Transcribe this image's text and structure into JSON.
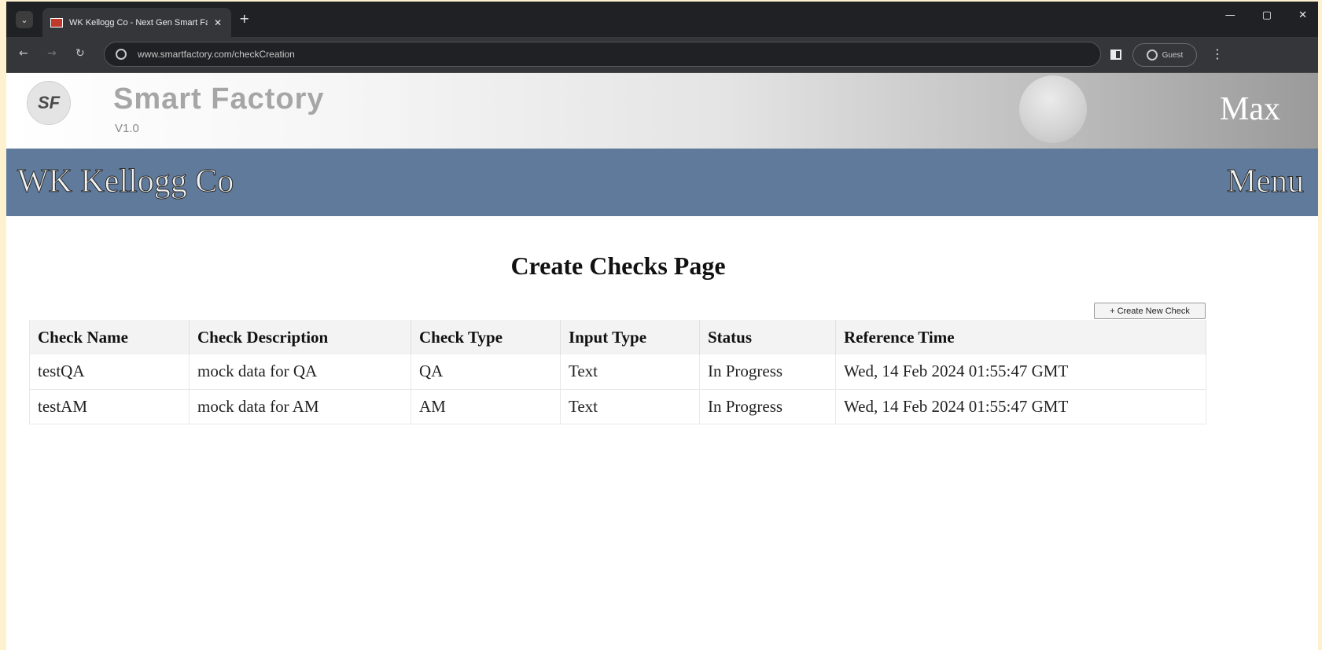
{
  "browser": {
    "tab_title": "WK Kellogg Co - Next Gen Smart Factory",
    "tab_close": "✕",
    "new_tab": "+",
    "url": "www.smartfactory.com/checkCreation",
    "profile_label": "Guest",
    "window_controls": [
      "—",
      "▢",
      "✕"
    ]
  },
  "header": {
    "logo_text": "SF",
    "app_name": "Smart Factory",
    "version": "V1.0",
    "user_name": "Max"
  },
  "company_bar": {
    "company_name": "WK Kellogg Co",
    "menu_label": "Menu"
  },
  "main": {
    "page_title": "Create Checks Page",
    "create_button_label": "+ Create New Check",
    "table": {
      "columns": [
        "Check Name",
        "Check Description",
        "Check Type",
        "Input Type",
        "Status",
        "Reference Time"
      ],
      "rows": [
        [
          "testQA",
          "mock data for QA",
          "QA",
          "Text",
          "In Progress",
          "Wed, 14 Feb 2024 01:55:47 GMT"
        ],
        [
          "testAM",
          "mock data for AM",
          "AM",
          "Text",
          "In Progress",
          "Wed, 14 Feb 2024 01:55:47 GMT"
        ]
      ]
    }
  },
  "colors": {
    "company_bar": "#5f7a9a",
    "browser_dark": "#202124",
    "page_background": "#ffffff"
  }
}
